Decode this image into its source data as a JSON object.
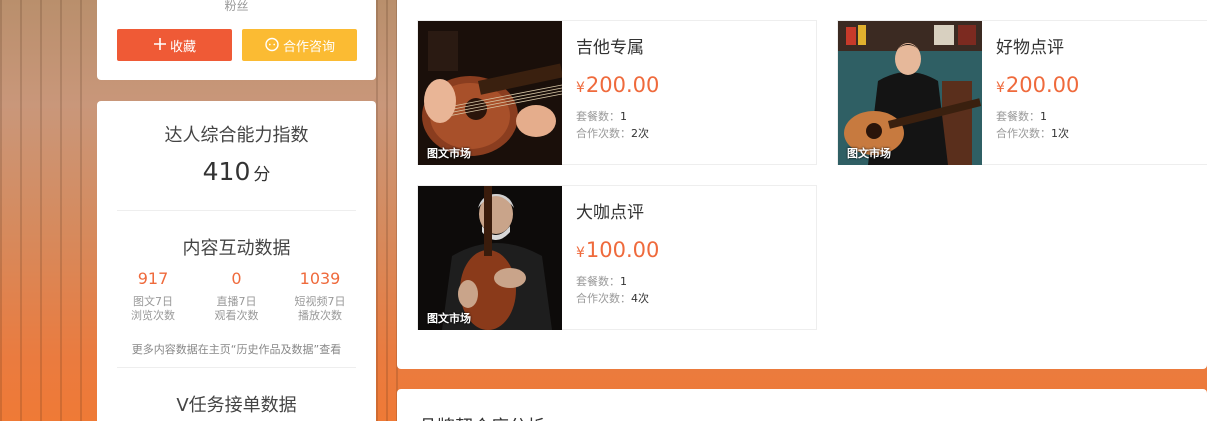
{
  "profile": {
    "fans_label": "粉丝",
    "favorite_button": "收藏",
    "favorite_icon": "plus-icon",
    "cooperate_button": "合作咨询",
    "cooperate_icon": "chat-icon"
  },
  "metrics": {
    "ability_title": "达人综合能力指数",
    "score": "410",
    "score_unit": "分",
    "interaction_title": "内容互动数据",
    "stats": [
      {
        "value": "917",
        "label": "图文7日\n浏览次数"
      },
      {
        "value": "0",
        "label": "直播7日\n观看次数"
      },
      {
        "value": "1039",
        "label": "短视频7日\n播放次数"
      }
    ],
    "more_note": "更多内容数据在主页“历史作品及数据”查看",
    "task_title": "V任务接单数据"
  },
  "packages": [
    {
      "title": "吉他专属",
      "currency": "¥",
      "price": "200.00",
      "count_label": "套餐数：",
      "count": "1",
      "coop_label": "合作次数：",
      "coop": "2次",
      "tag": "图文市场"
    },
    {
      "title": "好物点评",
      "currency": "¥",
      "price": "200.00",
      "count_label": "套餐数：",
      "count": "1",
      "coop_label": "合作次数：",
      "coop": "1次",
      "tag": "图文市场"
    },
    {
      "title": "大咖点评",
      "currency": "¥",
      "price": "100.00",
      "count_label": "套餐数：",
      "count": "1",
      "coop_label": "合作次数：",
      "coop": "4次",
      "tag": "图文市场"
    }
  ],
  "brand": {
    "title": "品牌契合度分析"
  },
  "colors": {
    "accent": "#ef6a3c",
    "favorite": "#ef5a36",
    "cooperate": "#fbbb33"
  }
}
